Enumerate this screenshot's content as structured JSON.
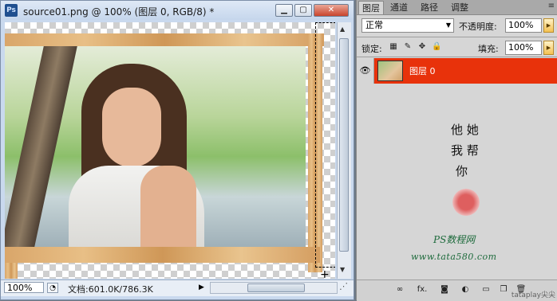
{
  "document": {
    "title": "source01.png @ 100% (图层 0, RGB/8) *",
    "app_icon": "Ps",
    "buttons": {
      "minimize": "▁",
      "maximize": "▢",
      "close": "✕"
    },
    "status": {
      "zoom": "100%",
      "doc_size": "文档:601.0K/786.3K"
    }
  },
  "layers_panel": {
    "tabs": [
      {
        "label": "图层",
        "active": true
      },
      {
        "label": "通道",
        "active": false
      },
      {
        "label": "路径",
        "active": false
      },
      {
        "label": "调整",
        "active": false
      }
    ],
    "menu_icon": "≡",
    "blend_mode": "正常",
    "opacity_label": "不透明度:",
    "opacity_value": "100%",
    "lock_label": "锁定:",
    "fill_label": "填充:",
    "fill_value": "100%",
    "layers": [
      {
        "name": "图层 0",
        "visible": true,
        "selected": true
      }
    ],
    "watermark": {
      "line1": "他 她",
      "line2": "我 帮",
      "line3": "你",
      "ps_text": "PS数程网",
      "url": "www.tata580.com"
    },
    "corner_watermark": "tataplay尖尖"
  },
  "colors": {
    "selected_layer": "#e8320b",
    "panel_bg": "#d6d6d6",
    "window_frame": "#c9d9ee"
  }
}
